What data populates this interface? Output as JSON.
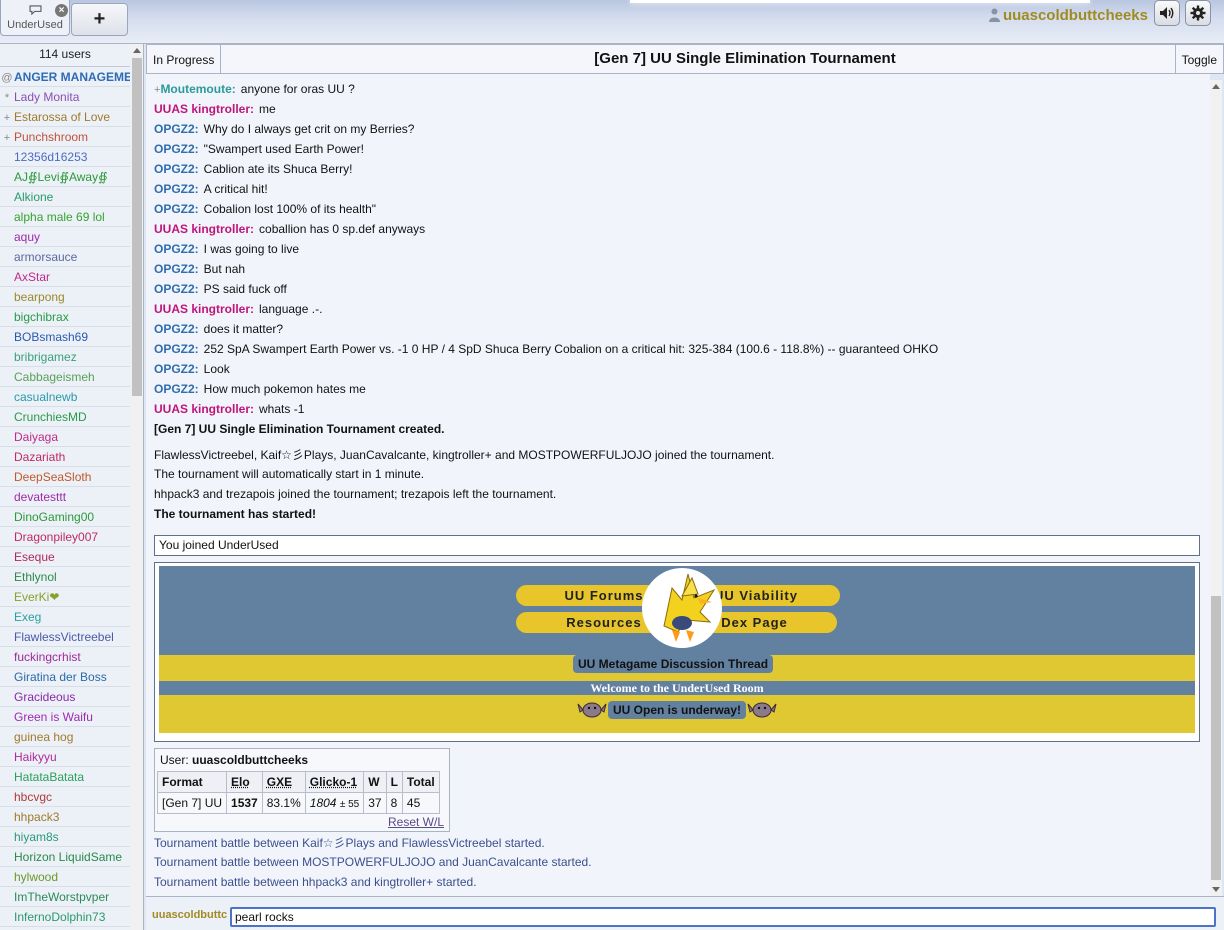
{
  "top": {
    "room_tab_label": "UnderUsed",
    "add_tab_label": "+",
    "username": "uuascoldbuttcheeks"
  },
  "userlist": {
    "count": "114 users",
    "users": [
      {
        "rank": "@",
        "name": "ANGER MANAGEME",
        "color": "#2e6bb5",
        "bold": true
      },
      {
        "rank": "*",
        "name": "Lady Monita",
        "color": "#8a4fb5"
      },
      {
        "rank": "+",
        "name": "Estarossa of Love",
        "color": "#a07b2a"
      },
      {
        "rank": "+",
        "name": "Punchshroom",
        "color": "#c0523a"
      },
      {
        "rank": "",
        "name": "12356d16253",
        "color": "#4b6cc0"
      },
      {
        "rank": "",
        "name": "AJ∯Levi∯Away∯",
        "color": "#2a9a3a"
      },
      {
        "rank": "",
        "name": "Alkione",
        "color": "#2a9a6a"
      },
      {
        "rank": "",
        "name": "alpha male 69 lol",
        "color": "#34a42c"
      },
      {
        "rank": "",
        "name": "aquy",
        "color": "#a02aa8"
      },
      {
        "rank": "",
        "name": "armorsauce",
        "color": "#5a6a9e"
      },
      {
        "rank": "",
        "name": "AxStar",
        "color": "#c02a8a"
      },
      {
        "rank": "",
        "name": "bearpong",
        "color": "#9a8a2a"
      },
      {
        "rank": "",
        "name": "bigchibrax",
        "color": "#2a9a4a"
      },
      {
        "rank": "",
        "name": "BOBsmash69",
        "color": "#2a5ab0"
      },
      {
        "rank": "",
        "name": "bribrigamez",
        "color": "#3aa07a"
      },
      {
        "rank": "",
        "name": "Cabbageismeh",
        "color": "#5aa05a"
      },
      {
        "rank": "",
        "name": "casualnewb",
        "color": "#2a9aa8"
      },
      {
        "rank": "",
        "name": "CrunchiesMD",
        "color": "#2a9a4a"
      },
      {
        "rank": "",
        "name": "Daiyaga",
        "color": "#c02a8a"
      },
      {
        "rank": "",
        "name": "Dazariath",
        "color": "#c02a6a"
      },
      {
        "rank": "",
        "name": "DeepSeaSloth",
        "color": "#c05a2a"
      },
      {
        "rank": "",
        "name": "devatesttt",
        "color": "#a02aa8"
      },
      {
        "rank": "",
        "name": "DinoGaming00",
        "color": "#2a9a3a"
      },
      {
        "rank": "",
        "name": "Dragonpiley007",
        "color": "#c02a6a"
      },
      {
        "rank": "",
        "name": "Eseque",
        "color": "#b02a5a"
      },
      {
        "rank": "",
        "name": "Ethlynol",
        "color": "#2a8a4a"
      },
      {
        "rank": "",
        "name": "EverKi❤",
        "color": "#8aa02a"
      },
      {
        "rank": "",
        "name": "Exeg",
        "color": "#2aa0a0"
      },
      {
        "rank": "",
        "name": "FlawlessVictreebel",
        "color": "#4a5aa8"
      },
      {
        "rank": "",
        "name": "fuckingcrhist",
        "color": "#a02a9a"
      },
      {
        "rank": "",
        "name": "Giratina der Boss",
        "color": "#2a6aa8"
      },
      {
        "rank": "",
        "name": "Gracideous",
        "color": "#8a2aa8"
      },
      {
        "rank": "",
        "name": "Green is Waifu",
        "color": "#a02ab0"
      },
      {
        "rank": "",
        "name": "guinea hog",
        "color": "#a07a2a"
      },
      {
        "rank": "",
        "name": "Haikyyu",
        "color": "#b02a9a"
      },
      {
        "rank": "",
        "name": "HatataBatata",
        "color": "#2aa05a"
      },
      {
        "rank": "",
        "name": "hbcvgc",
        "color": "#b03a3a"
      },
      {
        "rank": "",
        "name": "hhpack3",
        "color": "#a07a2a"
      },
      {
        "rank": "",
        "name": "hiyam8s",
        "color": "#2a9a7a"
      },
      {
        "rank": "",
        "name": "Horizon LiquidSame",
        "color": "#2a8a4a"
      },
      {
        "rank": "",
        "name": "hylwood",
        "color": "#6a9a2a"
      },
      {
        "rank": "",
        "name": "ImTheWorstpvper",
        "color": "#2a8a5a"
      },
      {
        "rank": "",
        "name": "InfernoDolphin73",
        "color": "#2a9a6a"
      }
    ]
  },
  "header": {
    "in_progress": "In Progress",
    "title": "[Gen 7] UU Single Elimination Tournament",
    "toggle": "Toggle"
  },
  "chat": {
    "messages": [
      {
        "rank": "+",
        "user": "Moutemoute:",
        "color": "#2a9a9a",
        "text": "anyone for oras UU ?"
      },
      {
        "rank": "",
        "user": "UUAS kingtroller:",
        "color": "#c0147a",
        "text": "me"
      },
      {
        "rank": "",
        "user": "OPGZ2:",
        "color": "#2f6db0",
        "text": "Why do I always get crit on my Berries?"
      },
      {
        "rank": "",
        "user": "OPGZ2:",
        "color": "#2f6db0",
        "text": "\"Swampert used Earth Power!"
      },
      {
        "rank": "",
        "user": "OPGZ2:",
        "color": "#2f6db0",
        "text": "Cablion ate its Shuca Berry!"
      },
      {
        "rank": "",
        "user": "OPGZ2:",
        "color": "#2f6db0",
        "text": "A critical hit!"
      },
      {
        "rank": "",
        "user": "OPGZ2:",
        "color": "#2f6db0",
        "text": "Cobalion lost 100% of its health\""
      },
      {
        "rank": "",
        "user": "UUAS kingtroller:",
        "color": "#c0147a",
        "text": "coballion has 0 sp.def anyways"
      },
      {
        "rank": "",
        "user": "OPGZ2:",
        "color": "#2f6db0",
        "text": "I was going to live"
      },
      {
        "rank": "",
        "user": "OPGZ2:",
        "color": "#2f6db0",
        "text": "But nah"
      },
      {
        "rank": "",
        "user": "OPGZ2:",
        "color": "#2f6db0",
        "text": "PS said fuck off"
      },
      {
        "rank": "",
        "user": "UUAS kingtroller:",
        "color": "#c0147a",
        "text": "language .-."
      },
      {
        "rank": "",
        "user": "OPGZ2:",
        "color": "#2f6db0",
        "text": "does it matter?"
      },
      {
        "rank": "",
        "user": "OPGZ2:",
        "color": "#2f6db0",
        "text": "252 SpA Swampert Earth Power vs. -1 0 HP / 4 SpD Shuca Berry Cobalion on a critical hit: 325-384 (100.6 - 118.8%) -- guaranteed OHKO"
      },
      {
        "rank": "",
        "user": "OPGZ2:",
        "color": "#2f6db0",
        "text": "Look"
      },
      {
        "rank": "",
        "user": "OPGZ2:",
        "color": "#2f6db0",
        "text": "How much pokemon hates me"
      },
      {
        "rank": "",
        "user": "UUAS kingtroller:",
        "color": "#c0147a",
        "text": "whats -1"
      }
    ],
    "tour_created": "[Gen 7] UU Single Elimination Tournament created.",
    "joined_line": "FlawlessVictreebel, Kaif☆彡Plays, JuanCavalcante, kingtroller+ and MOSTPOWERFULJOJO joined the tournament.",
    "auto_start": "The tournament will automatically start in 1 minute.",
    "joined_left": "hhpack3 and trezapois joined the tournament; trezapois left the tournament.",
    "started": "The tournament has started!",
    "you_joined": "You joined UnderUsed",
    "banner": {
      "forums": "UU Forums",
      "viability": "UU Viability",
      "resources": "Resources",
      "dex": "Dex Page",
      "discussion": "UU Metagame Discussion Thread",
      "welcome": "Welcome to the UnderUsed Room",
      "open": "UU Open is underway!"
    },
    "rank": {
      "user_label": "User:",
      "user": "uuascoldbuttcheeks",
      "headers": [
        "Format",
        "Elo",
        "GXE",
        "Glicko-1",
        "W",
        "L",
        "Total"
      ],
      "row": {
        "format": "[Gen 7] UU",
        "elo": "1537",
        "gxe": "83.1%",
        "glicko": "1804",
        "glicko_dev": "± 55",
        "w": "37",
        "l": "8",
        "total": "45"
      },
      "reset": "Reset W/L"
    },
    "battles": [
      "Tournament battle between Kaif☆彡Plays and FlawlessVictreebel started.",
      "Tournament battle between MOSTPOWERFULJOJO and JuanCavalcante started.",
      "Tournament battle between hhpack3 and kingtroller+ started."
    ]
  },
  "input": {
    "me": "uuascoldbuttc",
    "value": "pearl rocks"
  }
}
